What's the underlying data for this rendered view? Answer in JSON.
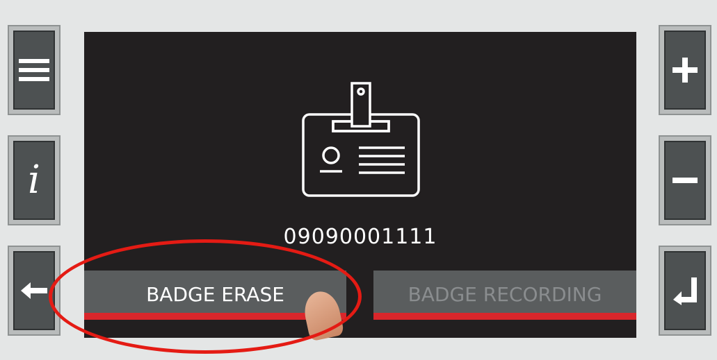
{
  "left_buttons": [
    {
      "icon": "menu-icon"
    },
    {
      "icon": "info-icon",
      "glyph": "i"
    },
    {
      "icon": "arrow-left-icon",
      "glyph": "←"
    }
  ],
  "right_buttons": [
    {
      "icon": "plus-icon",
      "glyph": "+"
    },
    {
      "icon": "minus-icon",
      "glyph": "−"
    },
    {
      "icon": "enter-return-icon",
      "glyph": "↵"
    }
  ],
  "screen": {
    "badge_icon": "id-badge-icon",
    "badge_number": "09090001111",
    "erase_button_label": "BADGE ERASE",
    "record_button_label": "BADGE RECORDING"
  },
  "colors": {
    "screen_background": "#221f20",
    "accent_red": "#d9262b",
    "annotation_red": "#e41b14",
    "button_gray": "#5a5d5e",
    "disabled_text": "#8a8d8f"
  }
}
